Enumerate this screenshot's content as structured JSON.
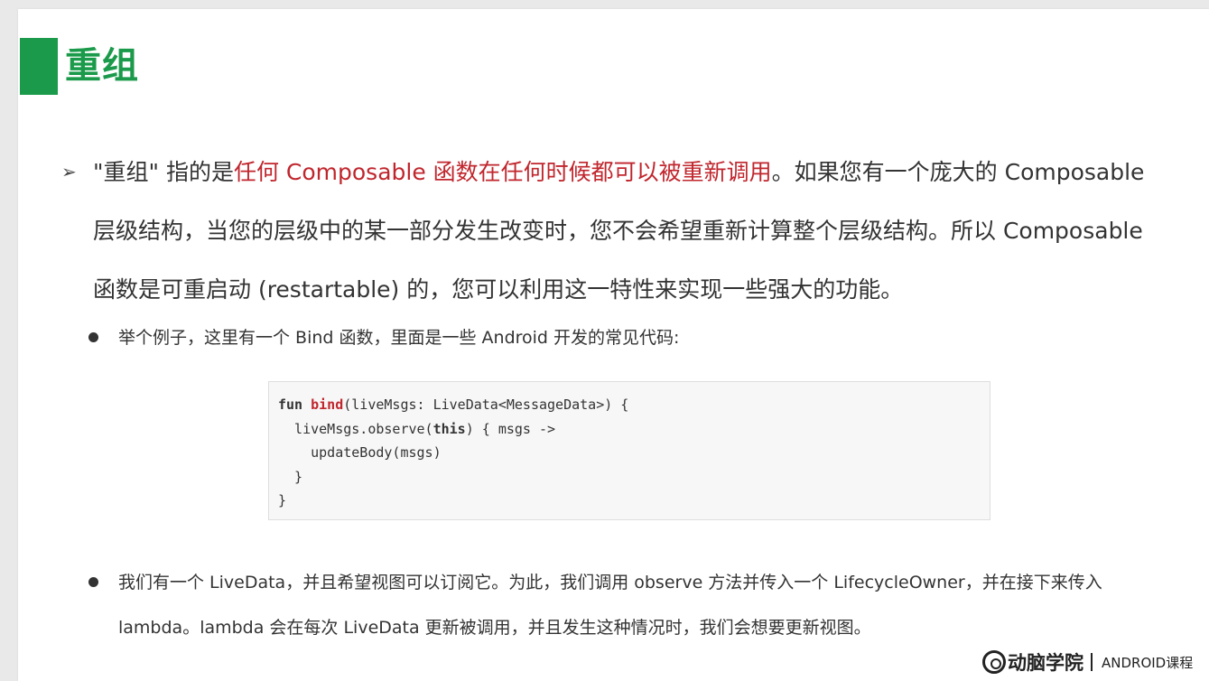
{
  "slide": {
    "title": "重组",
    "paragraph": {
      "before": "\"重组\" 指的是",
      "highlight": "任何 Composable 函数在任何时候都可以被重新调用",
      "after": "。如果您有一个庞大的 Composable 层级结构，当您的层级中的某一部分发生改变时，您不会希望重新计算整个层级结构。所以 Composable 函数是可重启动 (restartable) 的，您可以利用这一特性来实现一些强大的功能。"
    },
    "bullets": [
      "举个例子，这里有一个 Bind 函数，里面是一些 Android 开发的常见代码:",
      "我们有一个 LiveData，并且希望视图可以订阅它。为此，我们调用 observe 方法并传入一个 LifecycleOwner，并在接下来传入 lambda。lambda 会在每次 LiveData 更新被调用，并且发生这种情况时，我们会想要更新视图。"
    ],
    "code": {
      "l1_kw": "fun ",
      "l1_fn": "bind",
      "l1_rest": "(liveMsgs: LiveData<MessageData>) {",
      "l2_pre": "  liveMsgs.observe(",
      "l2_kw": "this",
      "l2_rest": ") { msgs ->",
      "l3": "    updateBody(msgs)",
      "l4": "  }",
      "l5": "}"
    },
    "footer": {
      "brand": "动脑学院",
      "course": "ANDROID课程"
    }
  },
  "colors": {
    "accent_green": "#1a9a4a",
    "highlight_red": "#c0262d"
  }
}
